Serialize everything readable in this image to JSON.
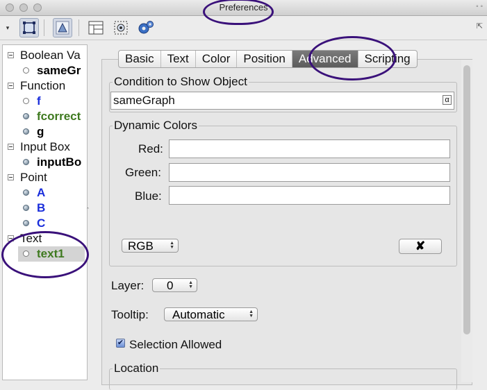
{
  "window": {
    "title": "Preferences",
    "controls_right": "◦ ◦"
  },
  "toolbar": {
    "icons": [
      "select-object-icon",
      "graphics-view-icon",
      "layout-icon",
      "defaults-icon",
      "advanced-settings-icon"
    ],
    "right_control": "⇱"
  },
  "tree": {
    "categories": [
      {
        "label": "Boolean Va",
        "items": [
          {
            "label": "sameGr",
            "color": "#000000",
            "dot": "empty"
          }
        ]
      },
      {
        "label": "Function",
        "items": [
          {
            "label": "f",
            "color": "#1a2edb",
            "dot": "empty"
          },
          {
            "label": "fcorrect",
            "color": "#3f7a20",
            "dot": "fill"
          },
          {
            "label": "g",
            "color": "#000000",
            "dot": "fill"
          }
        ]
      },
      {
        "label": "Input Box",
        "items": [
          {
            "label": "inputBo",
            "color": "#000000",
            "dot": "fill"
          }
        ]
      },
      {
        "label": "Point",
        "items": [
          {
            "label": "A",
            "color": "#1a2edb",
            "dot": "fill"
          },
          {
            "label": "B",
            "color": "#1a2edb",
            "dot": "fill"
          },
          {
            "label": "C",
            "color": "#1a2edb",
            "dot": "fill"
          }
        ]
      },
      {
        "label": "Text",
        "items": [
          {
            "label": "text1",
            "color": "#3f7a20",
            "dot": "empty",
            "selected": true
          }
        ]
      }
    ]
  },
  "tabs": {
    "items": [
      "Basic",
      "Text",
      "Color",
      "Position",
      "Advanced",
      "Scripting"
    ],
    "active": "Advanced"
  },
  "condition": {
    "legend": "Condition to Show Object",
    "value": "sameGraph",
    "alpha": "α"
  },
  "dynamic_colors": {
    "legend": "Dynamic Colors",
    "red_label": "Red:",
    "red_value": "",
    "green_label": "Green:",
    "green_value": "",
    "blue_label": "Blue:",
    "blue_value": "",
    "mode": "RGB",
    "clear_button": "✘"
  },
  "layer": {
    "label": "Layer:",
    "value": "0"
  },
  "tooltip": {
    "label": "Tooltip:",
    "value": "Automatic"
  },
  "selection": {
    "label": "Selection Allowed",
    "checked": true
  },
  "location": {
    "legend": "Location"
  },
  "colors": {
    "annotation": "#3a117a",
    "tab_active": "#666666"
  }
}
